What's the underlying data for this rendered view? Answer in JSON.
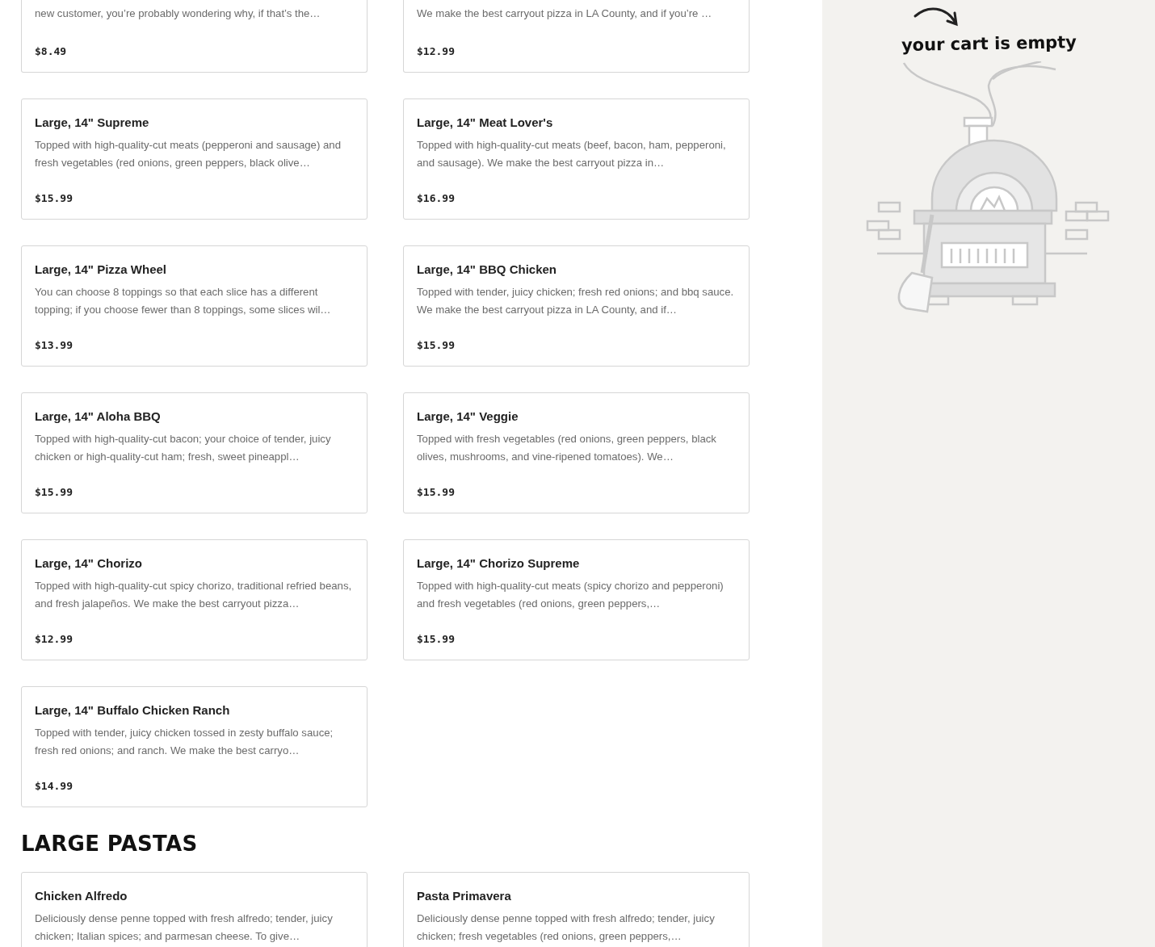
{
  "sections": [
    {
      "items": [
        {
          "kind": "cut",
          "description": "new customer, you’re probably wondering why, if that’s the…",
          "price": "$8.49"
        },
        {
          "kind": "cut",
          "description": "We make the best carryout pizza in LA County, and if you’re …",
          "price": "$12.99"
        },
        {
          "kind": "full",
          "name": "Large, 14\" Supreme",
          "description": "Topped with high-quality-cut meats (pepperoni and sausage) and fresh vegetables (red onions, green peppers, black olive…",
          "price": "$15.99"
        },
        {
          "kind": "full",
          "name": "Large, 14\" Meat Lover's",
          "description": "Topped with high-quality-cut meats (beef, bacon, ham, pepperoni, and sausage). We make the best carryout pizza in…",
          "price": "$16.99"
        },
        {
          "kind": "full",
          "name": "Large, 14\" Pizza Wheel",
          "description": "You can choose 8 toppings so that each slice has a different topping; if you choose fewer than 8 toppings, some slices wil…",
          "price": "$13.99"
        },
        {
          "kind": "full",
          "name": "Large, 14\" BBQ Chicken",
          "description": "Topped with tender, juicy chicken; fresh red onions; and bbq sauce. We make the best carryout pizza in LA County, and if…",
          "price": "$15.99"
        },
        {
          "kind": "full",
          "name": "Large, 14\" Aloha BBQ",
          "description": "Topped with high-quality-cut bacon; your choice of tender, juicy chicken or high-quality-cut ham; fresh, sweet pineappl…",
          "price": "$15.99"
        },
        {
          "kind": "full",
          "name": "Large, 14\" Veggie",
          "description": "Topped with fresh vegetables (red onions, green peppers, black olives, mushrooms, and vine-ripened tomatoes). We…",
          "price": "$15.99"
        },
        {
          "kind": "full",
          "name": "Large, 14\" Chorizo",
          "description": "Topped with high-quality-cut spicy chorizo, traditional refried beans, and fresh jalapeños. We make the best carryout pizza…",
          "price": "$12.99"
        },
        {
          "kind": "full",
          "name": "Large, 14\" Chorizo Supreme",
          "description": "Topped with high-quality-cut meats (spicy chorizo and pepperoni) and fresh vegetables (red onions, green peppers,…",
          "price": "$15.99"
        },
        {
          "kind": "full",
          "name": "Large, 14\" Buffalo Chicken Ranch",
          "description": "Topped with tender, juicy chicken tossed in zesty buffalo sauce; fresh red onions; and ranch. We make the best carryo…",
          "price": "$14.99"
        }
      ]
    },
    {
      "title": "LARGE PASTAS",
      "items": [
        {
          "kind": "full",
          "name": "Chicken Alfredo",
          "description": "Deliciously dense penne topped with fresh alfredo; tender, juicy chicken; Italian spices; and parmesan cheese. To give…"
        },
        {
          "kind": "full",
          "name": "Pasta Primavera",
          "description": "Deliciously dense penne topped with fresh alfredo; tender, juicy chicken; fresh vegetables (red onions, green peppers,…"
        }
      ]
    }
  ],
  "cart": {
    "message": "your cart is empty"
  }
}
